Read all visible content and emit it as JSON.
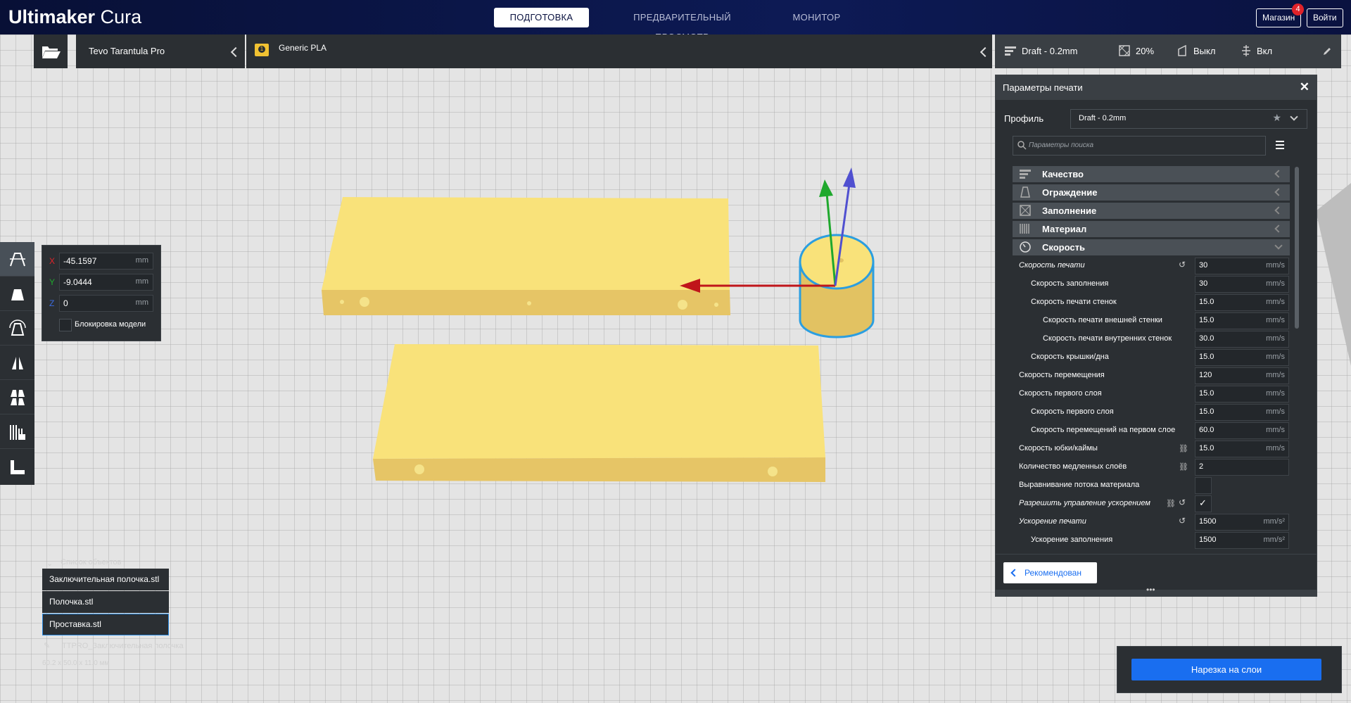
{
  "app": {
    "title_bold": "Ultimaker",
    "title_light": "Cura"
  },
  "stages": [
    {
      "label": "ПОДГОТОВКА",
      "active": true
    },
    {
      "label": "ПРЕДВАРИТЕЛЬНЫЙ ПРОСМОТР",
      "active": false
    },
    {
      "label": "МОНИТОР",
      "active": false
    }
  ],
  "header": {
    "market_label": "Магазин",
    "market_badge": "4",
    "login_label": "Войти"
  },
  "toolbar": {
    "printer_name": "Tevo Tarantula Pro",
    "material_number": "1",
    "material_name": "Generic PLA",
    "profile": "Draft - 0.2mm",
    "infill": "20%",
    "support": "Выкл",
    "adhesion": "Вкл"
  },
  "move_panel": {
    "x_label": "X",
    "x_value": "-45.1597",
    "y_label": "Y",
    "y_value": "-9.0444",
    "z_label": "Z",
    "z_value": "0",
    "unit": "mm",
    "lock_label": "Блокировка модели"
  },
  "object_list": {
    "title": "Список объектов",
    "items": [
      "Заключительная полочка.stl",
      "Полочка.stl",
      "Проставка.stl"
    ],
    "job_name": "TTPRO_Заключительная полочка",
    "dimensions": "60.2 x 50.0 x 11.0 мм"
  },
  "settings_panel": {
    "title": "Параметры печати",
    "profile_label": "Профиль",
    "profile_value": "Draft - 0.2mm",
    "search_placeholder": "Параметры поиска",
    "categories": [
      "Качество",
      "Ограждение",
      "Заполнение",
      "Материал",
      "Скорость"
    ],
    "rows": [
      {
        "label": "Скорость печати",
        "value": "30",
        "unit": "mm/s",
        "italic": true
      },
      {
        "label": "Скорость заполнения",
        "value": "30",
        "unit": "mm/s"
      },
      {
        "label": "Скорость печати стенок",
        "value": "15.0",
        "unit": "mm/s"
      },
      {
        "label": "Скорость печати внешней стенки",
        "value": "15.0",
        "unit": "mm/s"
      },
      {
        "label": "Скорость печати внутренних стенок",
        "value": "30.0",
        "unit": "mm/s"
      },
      {
        "label": "Скорость крышки/дна",
        "value": "15.0",
        "unit": "mm/s"
      },
      {
        "label": "Скорость перемещения",
        "value": "120",
        "unit": "mm/s"
      },
      {
        "label": "Скорость первого слоя",
        "value": "15.0",
        "unit": "mm/s"
      },
      {
        "label": "Скорость первого слоя",
        "value": "15.0",
        "unit": "mm/s"
      },
      {
        "label": "Скорость перемещений на первом слое",
        "value": "60.0",
        "unit": "mm/s"
      },
      {
        "label": "Скорость юбки/каймы",
        "value": "15.0",
        "unit": "mm/s"
      },
      {
        "label": "Количество медленных слоёв",
        "value": "2",
        "unit": ""
      },
      {
        "label": "Выравнивание потока материала",
        "value": "",
        "unit": ""
      },
      {
        "label": "Разрешить управление ускорением",
        "value": "",
        "unit": ""
      },
      {
        "label": "Ускорение печати",
        "value": "1500",
        "unit": "mm/s²"
      },
      {
        "label": "Ускорение заполнения",
        "value": "1500",
        "unit": "mm/s²"
      }
    ],
    "recommended_label": "Рекомендован"
  },
  "slice_button": "Нарезка на слои",
  "colors": {
    "model": "#f9e27a",
    "model_side": "#e2c262",
    "selection": "#2b9ee0",
    "accent": "#196ef0",
    "panel": "#2b2f33"
  }
}
